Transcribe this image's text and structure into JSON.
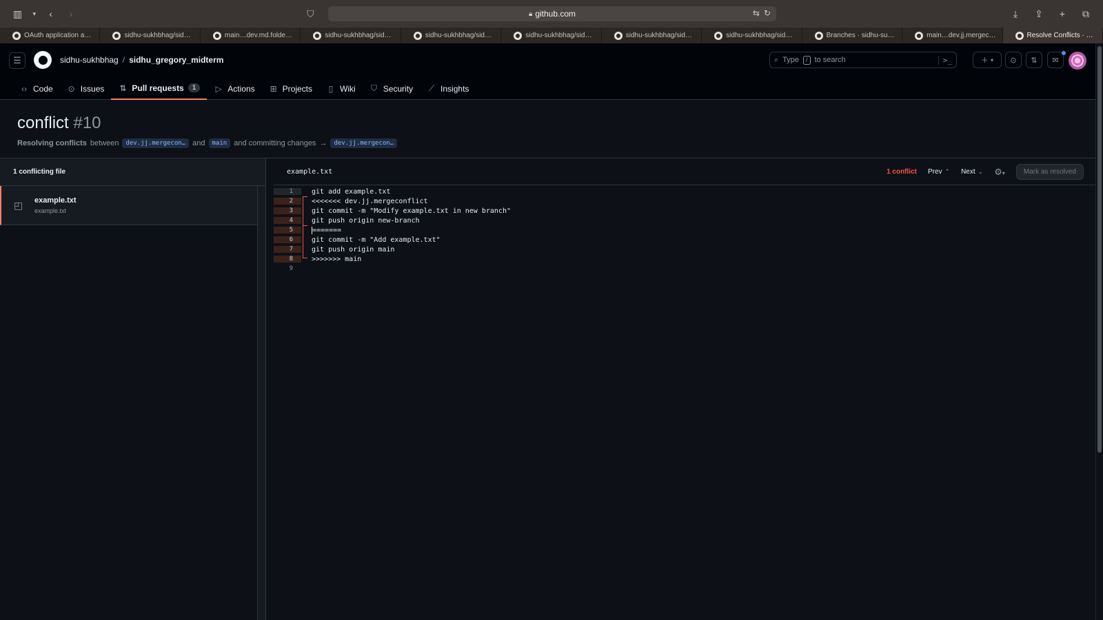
{
  "browser": {
    "url": "github.com",
    "tabs": [
      {
        "label": "OAuth application au…"
      },
      {
        "label": "sidhu-sukhbhag/sidh…"
      },
      {
        "label": "main…dev.md.folders…"
      },
      {
        "label": "sidhu-sukhbhag/sidh…"
      },
      {
        "label": "sidhu-sukhbhag/sidh…"
      },
      {
        "label": "sidhu-sukhbhag/sidh…"
      },
      {
        "label": "sidhu-sukhbhag/sidh…"
      },
      {
        "label": "sidhu-sukhbhag/sidh…"
      },
      {
        "label": "Branches · sidhu-suk…"
      },
      {
        "label": "main…dev.jj.mergec…"
      },
      {
        "label": "Resolve Conflicts · P…"
      }
    ],
    "active_tab_index": 10
  },
  "header": {
    "owner": "sidhu-sukhbhag",
    "separator": "/",
    "repo": "sidhu_gregory_midterm",
    "search_placeholder_pre": "Type",
    "search_key": "/",
    "search_placeholder_post": "to search",
    "command_glyph": ">_"
  },
  "repo_nav": {
    "items": [
      {
        "label": "Code",
        "icon": "code-icon"
      },
      {
        "label": "Issues",
        "icon": "issue-icon"
      },
      {
        "label": "Pull requests",
        "icon": "pull-request-icon",
        "count": "1"
      },
      {
        "label": "Actions",
        "icon": "play-icon"
      },
      {
        "label": "Projects",
        "icon": "table-icon"
      },
      {
        "label": "Wiki",
        "icon": "book-icon"
      },
      {
        "label": "Security",
        "icon": "shield-icon"
      },
      {
        "label": "Insights",
        "icon": "graph-icon"
      }
    ],
    "selected": "Pull requests"
  },
  "pr": {
    "title": "conflict",
    "number": "#10",
    "subtitle_strong": "Resolving conflicts",
    "between": "between",
    "head_branch": "dev.jj.mergecon…",
    "and": "and",
    "base_branch": "main",
    "committing": "and committing changes",
    "arrow": "→",
    "target_branch": "dev.jj.mergecon…"
  },
  "sidebar": {
    "heading": "1 conflicting file",
    "files": [
      {
        "name": "example.txt",
        "path": "example.txt"
      }
    ]
  },
  "editor": {
    "filename": "example.txt",
    "conflict_count": "1 conflict",
    "prev_label": "Prev",
    "next_label": "Next",
    "mark_resolved_label": "Mark as resolved",
    "lines": [
      {
        "n": "1",
        "text": "git add example.txt"
      },
      {
        "n": "2",
        "text": "<<<<<<< dev.jj.mergeconflict"
      },
      {
        "n": "3",
        "text": "git commit -m \"Modify example.txt in new branch\""
      },
      {
        "n": "4",
        "text": "git push origin new-branch"
      },
      {
        "n": "5",
        "text": "======="
      },
      {
        "n": "6",
        "text": "git commit -m \"Add example.txt\""
      },
      {
        "n": "7",
        "text": "git push origin main"
      },
      {
        "n": "8",
        "text": ">>>>>>> main"
      },
      {
        "n": "9",
        "text": ""
      }
    ]
  },
  "colors": {
    "accent_underline": "#f78166",
    "conflict_red": "#f85149",
    "bg": "#0d1117"
  }
}
